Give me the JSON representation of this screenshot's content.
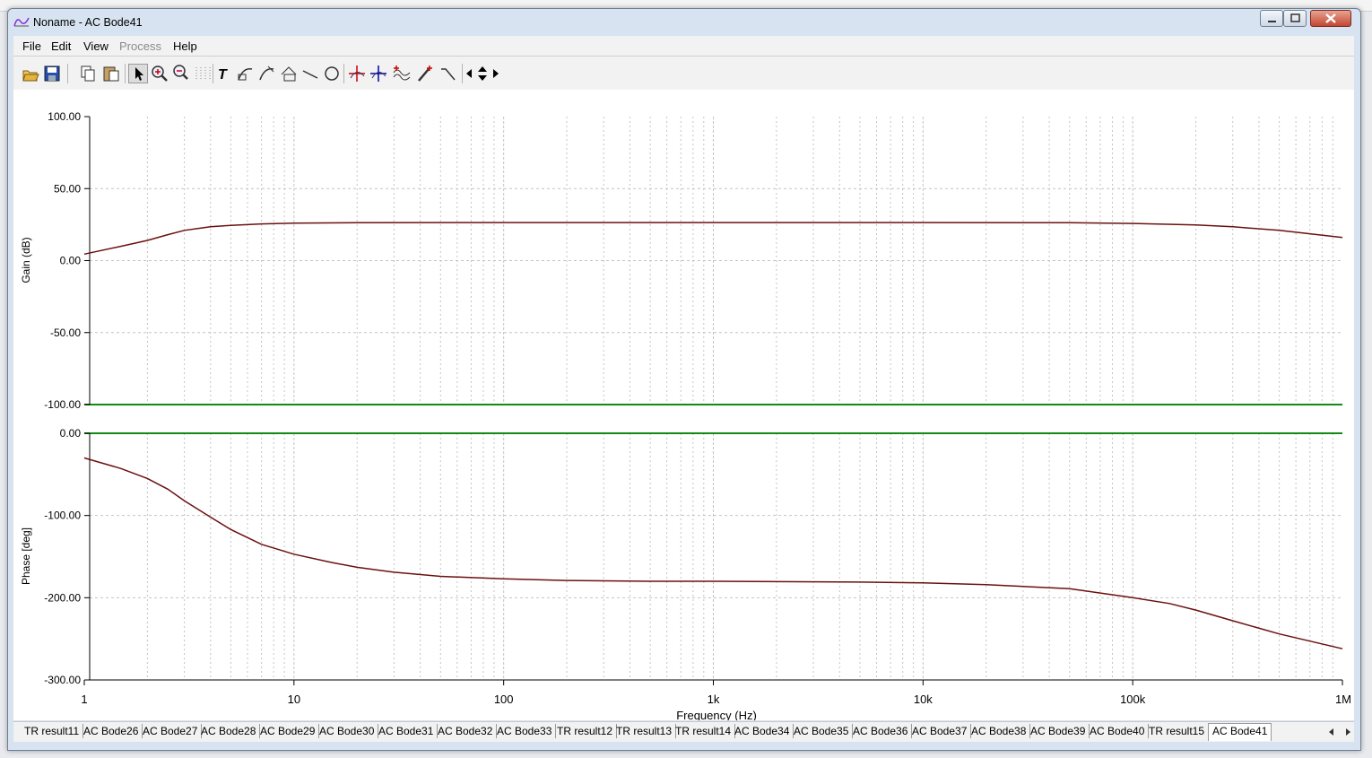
{
  "window": {
    "title": "Noname - AC Bode41"
  },
  "menu": [
    "File",
    "Edit",
    "View",
    "Process",
    "Help"
  ],
  "menu_disabled": [
    "Process"
  ],
  "toolbar": {
    "icons": [
      "open-icon",
      "save-icon",
      "copy-icon",
      "paste-icon",
      "pointer-icon",
      "zoom-in-icon",
      "zoom-100-icon",
      "grid-icon",
      "text-icon",
      "curve-label-icon",
      "curve-label-2-icon",
      "table-icon",
      "line-icon",
      "circle-icon",
      "cursor-a-icon",
      "cursor-b-icon",
      "waveform-icon",
      "probe-icon",
      "step-icon",
      "arrow-left-icon",
      "arrow-updown-icon",
      "arrow-right-icon"
    ]
  },
  "tabs": [
    "TR result11",
    "AC Bode26",
    "AC Bode27",
    "AC Bode28",
    "AC Bode29",
    "AC Bode30",
    "AC Bode31",
    "AC Bode32",
    "AC Bode33",
    "TR result12",
    "TR result13",
    "TR result14",
    "AC Bode34",
    "AC Bode35",
    "AC Bode36",
    "AC Bode37",
    "AC Bode38",
    "AC Bode39",
    "AC Bode40",
    "TR result15",
    "AC Bode41"
  ],
  "active_tab": "AC Bode41",
  "colors": {
    "trace": "#6b1010",
    "zero_line": "#138a13",
    "grid": "#c4c4c4"
  },
  "chart_data": [
    {
      "type": "line",
      "ylabel": "Gain (dB)",
      "xscale": "log",
      "xlim": [
        1,
        1000000
      ],
      "ylim": [
        -100,
        100
      ],
      "yticks": [
        "100.00",
        "50.00",
        "0.00",
        "-50.00",
        "-100.00"
      ],
      "grid": true,
      "series": [
        {
          "x": [
            1,
            1.5,
            2,
            2.5,
            3,
            4,
            5,
            7,
            10,
            20,
            50,
            100,
            1000,
            10000,
            50000,
            100000,
            200000,
            300000,
            500000,
            1000000
          ],
          "y": [
            4.5,
            10,
            14,
            18,
            21,
            23.5,
            24.5,
            25.5,
            26,
            26.3,
            26.4,
            26.4,
            26.4,
            26.4,
            26.3,
            25.8,
            24.8,
            23.5,
            21,
            16
          ]
        }
      ]
    },
    {
      "type": "line",
      "ylabel": "Phase [deg]",
      "xlabel": "Frequency (Hz)",
      "xscale": "log",
      "xlim": [
        1,
        1000000
      ],
      "ylim": [
        -300,
        0
      ],
      "yticks": [
        "0.00",
        "-100.00",
        "-200.00",
        "-300.00"
      ],
      "xticks": [
        "1",
        "10",
        "100",
        "1k",
        "10k",
        "100k",
        "1M"
      ],
      "grid": true,
      "series": [
        {
          "x": [
            1,
            1.5,
            2,
            2.5,
            3,
            4,
            5,
            7,
            10,
            15,
            20,
            30,
            50,
            100,
            200,
            500,
            1000,
            5000,
            10000,
            20000,
            50000,
            100000,
            150000,
            200000,
            300000,
            500000,
            1000000
          ],
          "y": [
            -30,
            -43,
            -55,
            -68,
            -82,
            -102,
            -117,
            -135,
            -147,
            -157,
            -163,
            -169,
            -174,
            -177,
            -179,
            -180,
            -180,
            -181,
            -182,
            -184,
            -189,
            -200,
            -207,
            -215,
            -228,
            -244,
            -262
          ]
        }
      ]
    }
  ]
}
